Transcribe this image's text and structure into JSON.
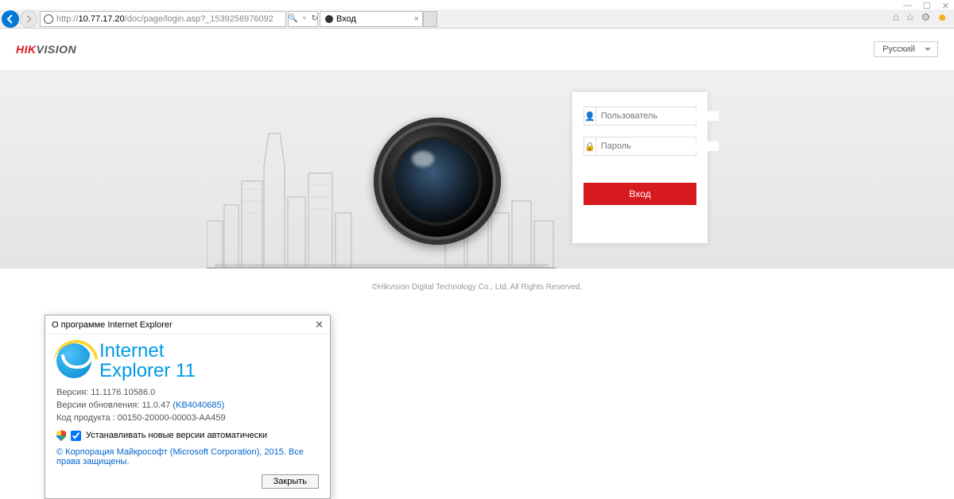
{
  "window_controls": {
    "minimize": "—",
    "maximize": "☐",
    "close": "✕"
  },
  "browser": {
    "url_prefix": "http://",
    "url_host": "10.77.17.20",
    "url_path": "/doc/page/login.asp?_1539256976092",
    "search_icon": "🔍",
    "refresh_icon": "↻",
    "tab_title": "Вход",
    "tab_close": "×",
    "toolbar": {
      "home": "⌂",
      "fav": "☆",
      "gear": "⚙",
      "smiley": "☻"
    }
  },
  "page": {
    "logo_a": "HIK",
    "logo_b": "VISION",
    "language": "Русский",
    "login": {
      "user_placeholder": "Пользователь",
      "pass_placeholder": "Пароль",
      "submit": "Вход"
    },
    "footer": "©Hikvision Digital Technology Co., Ltd. All Rights Reserved."
  },
  "about": {
    "title": "О программе Internet Explorer",
    "brand_line1": "Internet",
    "brand_line2": "Explorer 11",
    "version_label": "Версия:",
    "version": "11.1176.10586.0",
    "update_label": "Версии обновления:",
    "update_version": "11.0.47",
    "kb": "(KB4040685)",
    "product_label": "Код продукта :",
    "product_code": "00150-20000-00003-AA459",
    "auto_update": "Устанавливать новые версии автоматически",
    "copyright": "© Корпорация Майкрософт (Microsoft Corporation), 2015. Все права защищены.",
    "close_btn": "Закрыть"
  }
}
